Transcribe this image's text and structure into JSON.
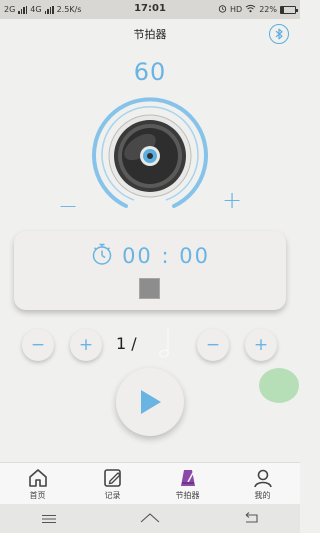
{
  "status_bar": {
    "left_text_1": "2G",
    "left_text_2": "4G",
    "speed": "2.5K/s",
    "time": "17:01",
    "hd": "HD",
    "battery": "22%"
  },
  "header": {
    "title": "节拍器",
    "bluetooth_icon": "bluetooth-icon"
  },
  "metronome": {
    "bpm": "60",
    "minus": "−",
    "plus": "+"
  },
  "timer": {
    "value": "00 : 00",
    "icon": "stopwatch-icon"
  },
  "beat": {
    "text": "1 /",
    "minus": "−",
    "plus": "+"
  },
  "note_controls": {
    "minus": "−",
    "plus": "+",
    "icon": "half-note-icon"
  },
  "nav": {
    "items": [
      {
        "label": "首页",
        "icon": "home-icon"
      },
      {
        "label": "记录",
        "icon": "edit-icon"
      },
      {
        "label": "节拍器",
        "icon": "metronome-icon"
      },
      {
        "label": "我的",
        "icon": "user-icon"
      }
    ]
  },
  "colors": {
    "accent": "#6ab4e4",
    "active_nav": "#8b4aa8",
    "floating_button": "#abdcae"
  }
}
